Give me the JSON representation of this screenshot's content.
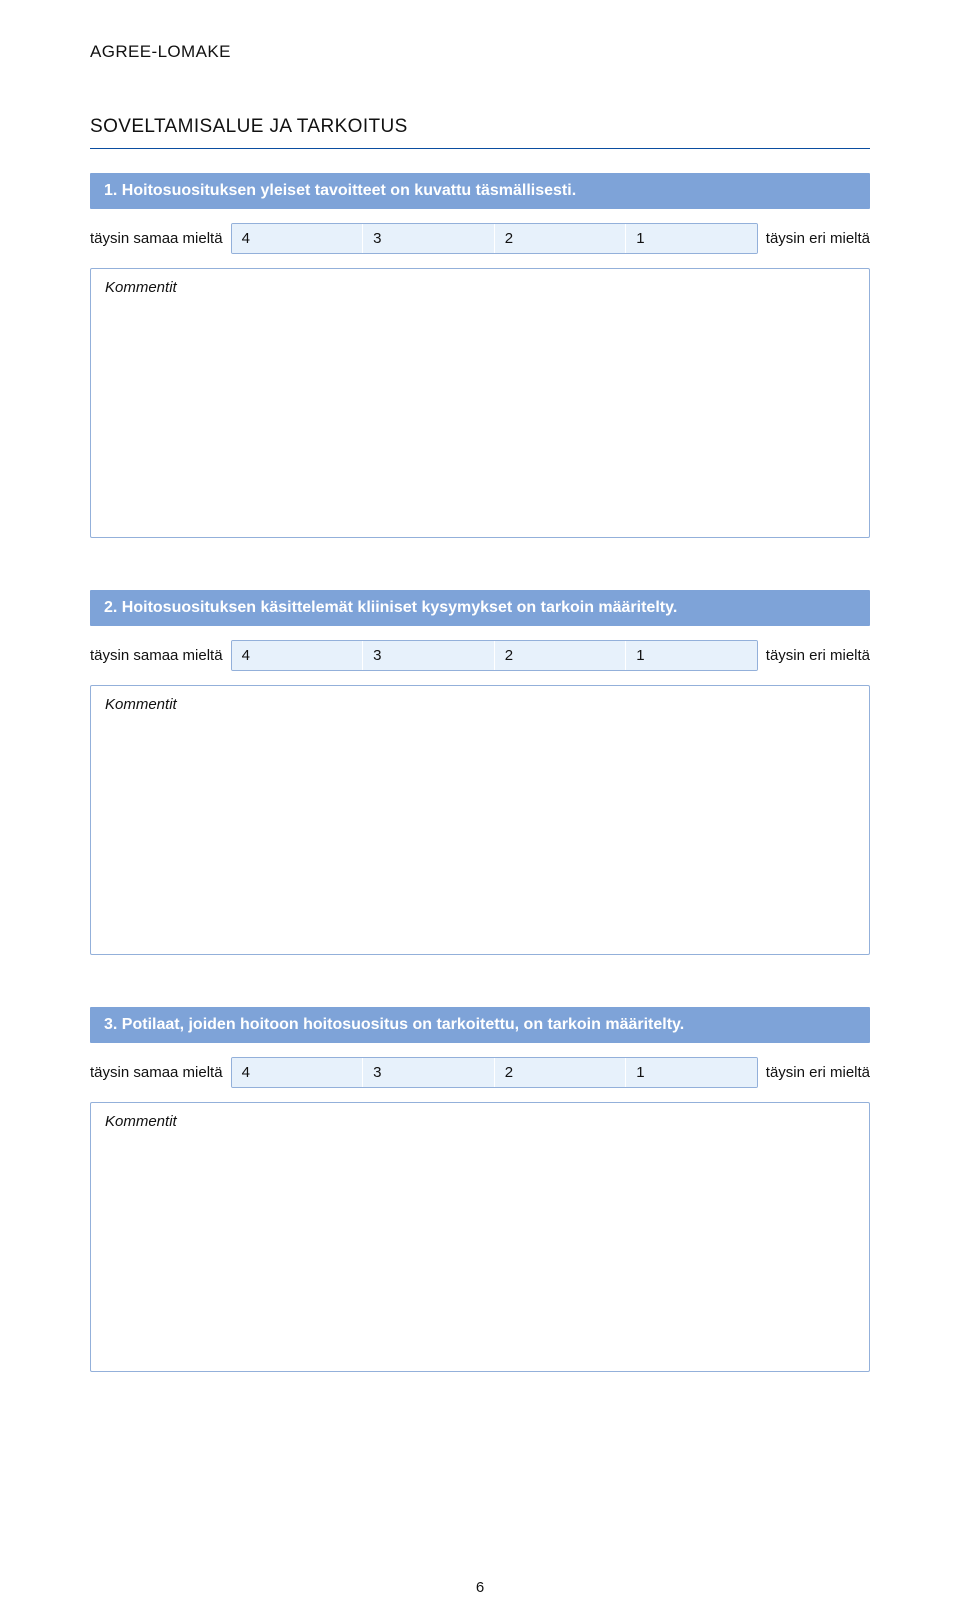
{
  "header_label": "AGREE-LOMAKE",
  "section_title": "SOVELTAMISALUE JA TARKOITUS",
  "rating_label_left": "täysin samaa mieltä",
  "rating_label_right": "täysin eri mieltä",
  "rating_options": [
    "4",
    "3",
    "2",
    "1"
  ],
  "comment_title": "Kommentit",
  "questions": [
    {
      "number": "1.",
      "text": "Hoitosuosituksen yleiset tavoitteet on kuvattu täsmällisesti."
    },
    {
      "number": "2.",
      "text": "Hoitosuosituksen käsittelemät kliiniset kysymykset on tarkoin määritelty."
    },
    {
      "number": "3.",
      "text": "Potilaat, joiden hoitoon hoitosuositus on tarkoitettu, on tarkoin määritelty."
    }
  ],
  "page_number": "6"
}
